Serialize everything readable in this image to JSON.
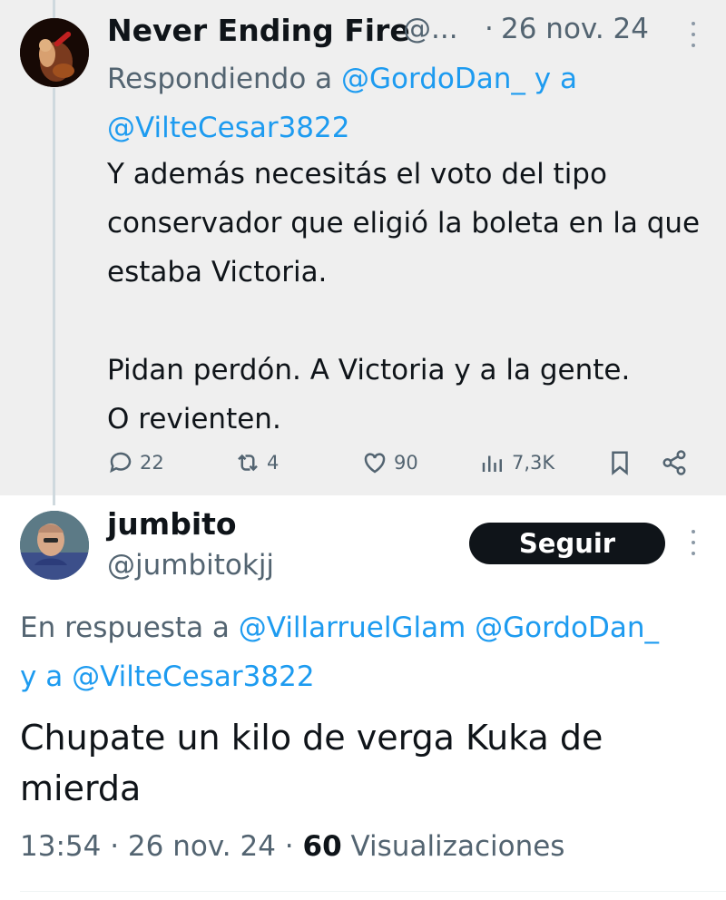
{
  "parent": {
    "author_name": "Never Ending Fire",
    "author_handle": "@...",
    "separator": "·",
    "date": "26 nov. 24",
    "reply_prefix": "Respondiendo a",
    "reply_mention_1": "@GordoDan_",
    "reply_joiner": "y a",
    "reply_mention_2": "@VilteCesar3822",
    "text": "Y además necesitás el voto del tipo conservador que eligió la boleta en la que estaba Victoria.\n\nPidan perdón.  A Victoria y a la gente.\nO revienten.",
    "actions": {
      "replies": "22",
      "retweets": "4",
      "likes": "90",
      "views": "7,3K"
    }
  },
  "reply": {
    "author_name": "jumbito",
    "author_handle": "@jumbitokjj",
    "follow_label": "Seguir",
    "reply_prefix": "En respuesta a",
    "reply_mention_1": "@VillarruelGlam",
    "reply_mention_2": "@GordoDan_",
    "reply_joiner": "y a",
    "reply_mention_3": "@VilteCesar3822",
    "text": "Chupate un kilo de verga Kuka de mierda",
    "time": "13:54",
    "separator": "·",
    "date": "26 nov. 24",
    "views_count": "60",
    "views_label": "Visualizaciones"
  },
  "icons": [
    "reply-icon",
    "retweet-icon",
    "like-icon",
    "views-icon",
    "bookmark-icon",
    "share-icon",
    "more-icon"
  ],
  "colors": {
    "parent_background": "#efefef",
    "mention": "#1d9bf0",
    "secondary_text": "#536471",
    "follow_button": "#0f1419"
  }
}
